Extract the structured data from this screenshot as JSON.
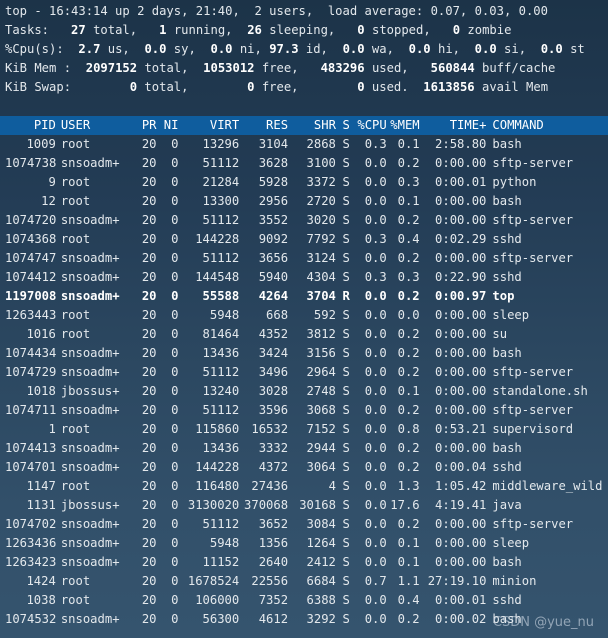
{
  "summary": {
    "uptime": "top - 16:43:14 up 2 days, 21:40,  2 users,  load average: 0.07, 0.03, 0.00",
    "tasks_label": "Tasks:",
    "tasks_total": "27",
    "tasks_total_label": "total,",
    "tasks_running": "1",
    "tasks_running_label": "running,",
    "tasks_sleeping": "26",
    "tasks_sleeping_label": "sleeping,",
    "tasks_stopped": "0",
    "tasks_stopped_label": "stopped,",
    "tasks_zombie": "0",
    "tasks_zombie_label": "zombie",
    "cpu_label": "%Cpu(s):",
    "cpu_us": "2.7",
    "cpu_sy": "0.0",
    "cpu_ni": "0.0",
    "cpu_id": "97.3",
    "cpu_wa": "0.0",
    "cpu_hi": "0.0",
    "cpu_si": "0.0",
    "cpu_st": "0.0",
    "mem_label": "KiB Mem :",
    "mem_total": "2097152",
    "mem_free": "1053012",
    "mem_used": "483296",
    "mem_buff": "560844",
    "swap_label": "KiB Swap:",
    "swap_total": "0",
    "swap_free": "0",
    "swap_used": "0",
    "swap_avail": "1613856"
  },
  "table": {
    "columns": [
      "PID",
      "USER",
      "PR",
      "NI",
      "VIRT",
      "RES",
      "SHR",
      "S",
      "%CPU",
      "%MEM",
      "TIME+",
      "COMMAND"
    ],
    "rows": [
      [
        "1009",
        "root",
        "20",
        "0",
        "13296",
        "3104",
        "2868",
        "S",
        "0.3",
        "0.1",
        "2:58.80",
        "bash"
      ],
      [
        "1074738",
        "snsoadm+",
        "20",
        "0",
        "51112",
        "3628",
        "3100",
        "S",
        "0.0",
        "0.2",
        "0:00.00",
        "sftp-server"
      ],
      [
        "9",
        "root",
        "20",
        "0",
        "21284",
        "5928",
        "3372",
        "S",
        "0.0",
        "0.3",
        "0:00.01",
        "python"
      ],
      [
        "12",
        "root",
        "20",
        "0",
        "13300",
        "2956",
        "2720",
        "S",
        "0.0",
        "0.1",
        "0:00.00",
        "bash"
      ],
      [
        "1074720",
        "snsoadm+",
        "20",
        "0",
        "51112",
        "3552",
        "3020",
        "S",
        "0.0",
        "0.2",
        "0:00.00",
        "sftp-server"
      ],
      [
        "1074368",
        "root",
        "20",
        "0",
        "144228",
        "9092",
        "7792",
        "S",
        "0.3",
        "0.4",
        "0:02.29",
        "sshd"
      ],
      [
        "1074747",
        "snsoadm+",
        "20",
        "0",
        "51112",
        "3656",
        "3124",
        "S",
        "0.0",
        "0.2",
        "0:00.00",
        "sftp-server"
      ],
      [
        "1074412",
        "snsoadm+",
        "20",
        "0",
        "144548",
        "5940",
        "4304",
        "S",
        "0.3",
        "0.3",
        "0:22.90",
        "sshd"
      ],
      [
        "1197008",
        "snsoadm+",
        "20",
        "0",
        "55588",
        "4264",
        "3704",
        "R",
        "0.0",
        "0.2",
        "0:00.97",
        "top"
      ],
      [
        "1263443",
        "root",
        "20",
        "0",
        "5948",
        "668",
        "592",
        "S",
        "0.0",
        "0.0",
        "0:00.00",
        "sleep"
      ],
      [
        "1016",
        "root",
        "20",
        "0",
        "81464",
        "4352",
        "3812",
        "S",
        "0.0",
        "0.2",
        "0:00.00",
        "su"
      ],
      [
        "1074434",
        "snsoadm+",
        "20",
        "0",
        "13436",
        "3424",
        "3156",
        "S",
        "0.0",
        "0.2",
        "0:00.00",
        "bash"
      ],
      [
        "1074729",
        "snsoadm+",
        "20",
        "0",
        "51112",
        "3496",
        "2964",
        "S",
        "0.0",
        "0.2",
        "0:00.00",
        "sftp-server"
      ],
      [
        "1018",
        "jbossus+",
        "20",
        "0",
        "13240",
        "3028",
        "2748",
        "S",
        "0.0",
        "0.1",
        "0:00.00",
        "standalone.sh"
      ],
      [
        "1074711",
        "snsoadm+",
        "20",
        "0",
        "51112",
        "3596",
        "3068",
        "S",
        "0.0",
        "0.2",
        "0:00.00",
        "sftp-server"
      ],
      [
        "1",
        "root",
        "20",
        "0",
        "115860",
        "16532",
        "7152",
        "S",
        "0.0",
        "0.8",
        "0:53.21",
        "supervisord"
      ],
      [
        "1074413",
        "snsoadm+",
        "20",
        "0",
        "13436",
        "3332",
        "2944",
        "S",
        "0.0",
        "0.2",
        "0:00.00",
        "bash"
      ],
      [
        "1074701",
        "snsoadm+",
        "20",
        "0",
        "144228",
        "4372",
        "3064",
        "S",
        "0.0",
        "0.2",
        "0:00.04",
        "sshd"
      ],
      [
        "1147",
        "root",
        "20",
        "0",
        "116480",
        "27436",
        "4",
        "S",
        "0.0",
        "1.3",
        "1:05.42",
        "middleware_wild"
      ],
      [
        "1131",
        "jbossus+",
        "20",
        "0",
        "3130020",
        "370068",
        "30168",
        "S",
        "0.0",
        "17.6",
        "4:19.41",
        "java"
      ],
      [
        "1074702",
        "snsoadm+",
        "20",
        "0",
        "51112",
        "3652",
        "3084",
        "S",
        "0.0",
        "0.2",
        "0:00.00",
        "sftp-server"
      ],
      [
        "1263436",
        "snsoadm+",
        "20",
        "0",
        "5948",
        "1356",
        "1264",
        "S",
        "0.0",
        "0.1",
        "0:00.00",
        "sleep"
      ],
      [
        "1263423",
        "snsoadm+",
        "20",
        "0",
        "11152",
        "2640",
        "2412",
        "S",
        "0.0",
        "0.1",
        "0:00.00",
        "bash"
      ],
      [
        "1424",
        "root",
        "20",
        "0",
        "1678524",
        "22556",
        "6684",
        "S",
        "0.7",
        "1.1",
        "27:19.10",
        "minion"
      ],
      [
        "1038",
        "root",
        "20",
        "0",
        "106000",
        "7352",
        "6388",
        "S",
        "0.0",
        "0.4",
        "0:00.01",
        "sshd"
      ],
      [
        "1074532",
        "snsoadm+",
        "20",
        "0",
        "56300",
        "4612",
        "3292",
        "S",
        "0.0",
        "0.2",
        "0:00.02",
        "bash"
      ]
    ]
  },
  "watermark": "CSDN @yue_nu"
}
